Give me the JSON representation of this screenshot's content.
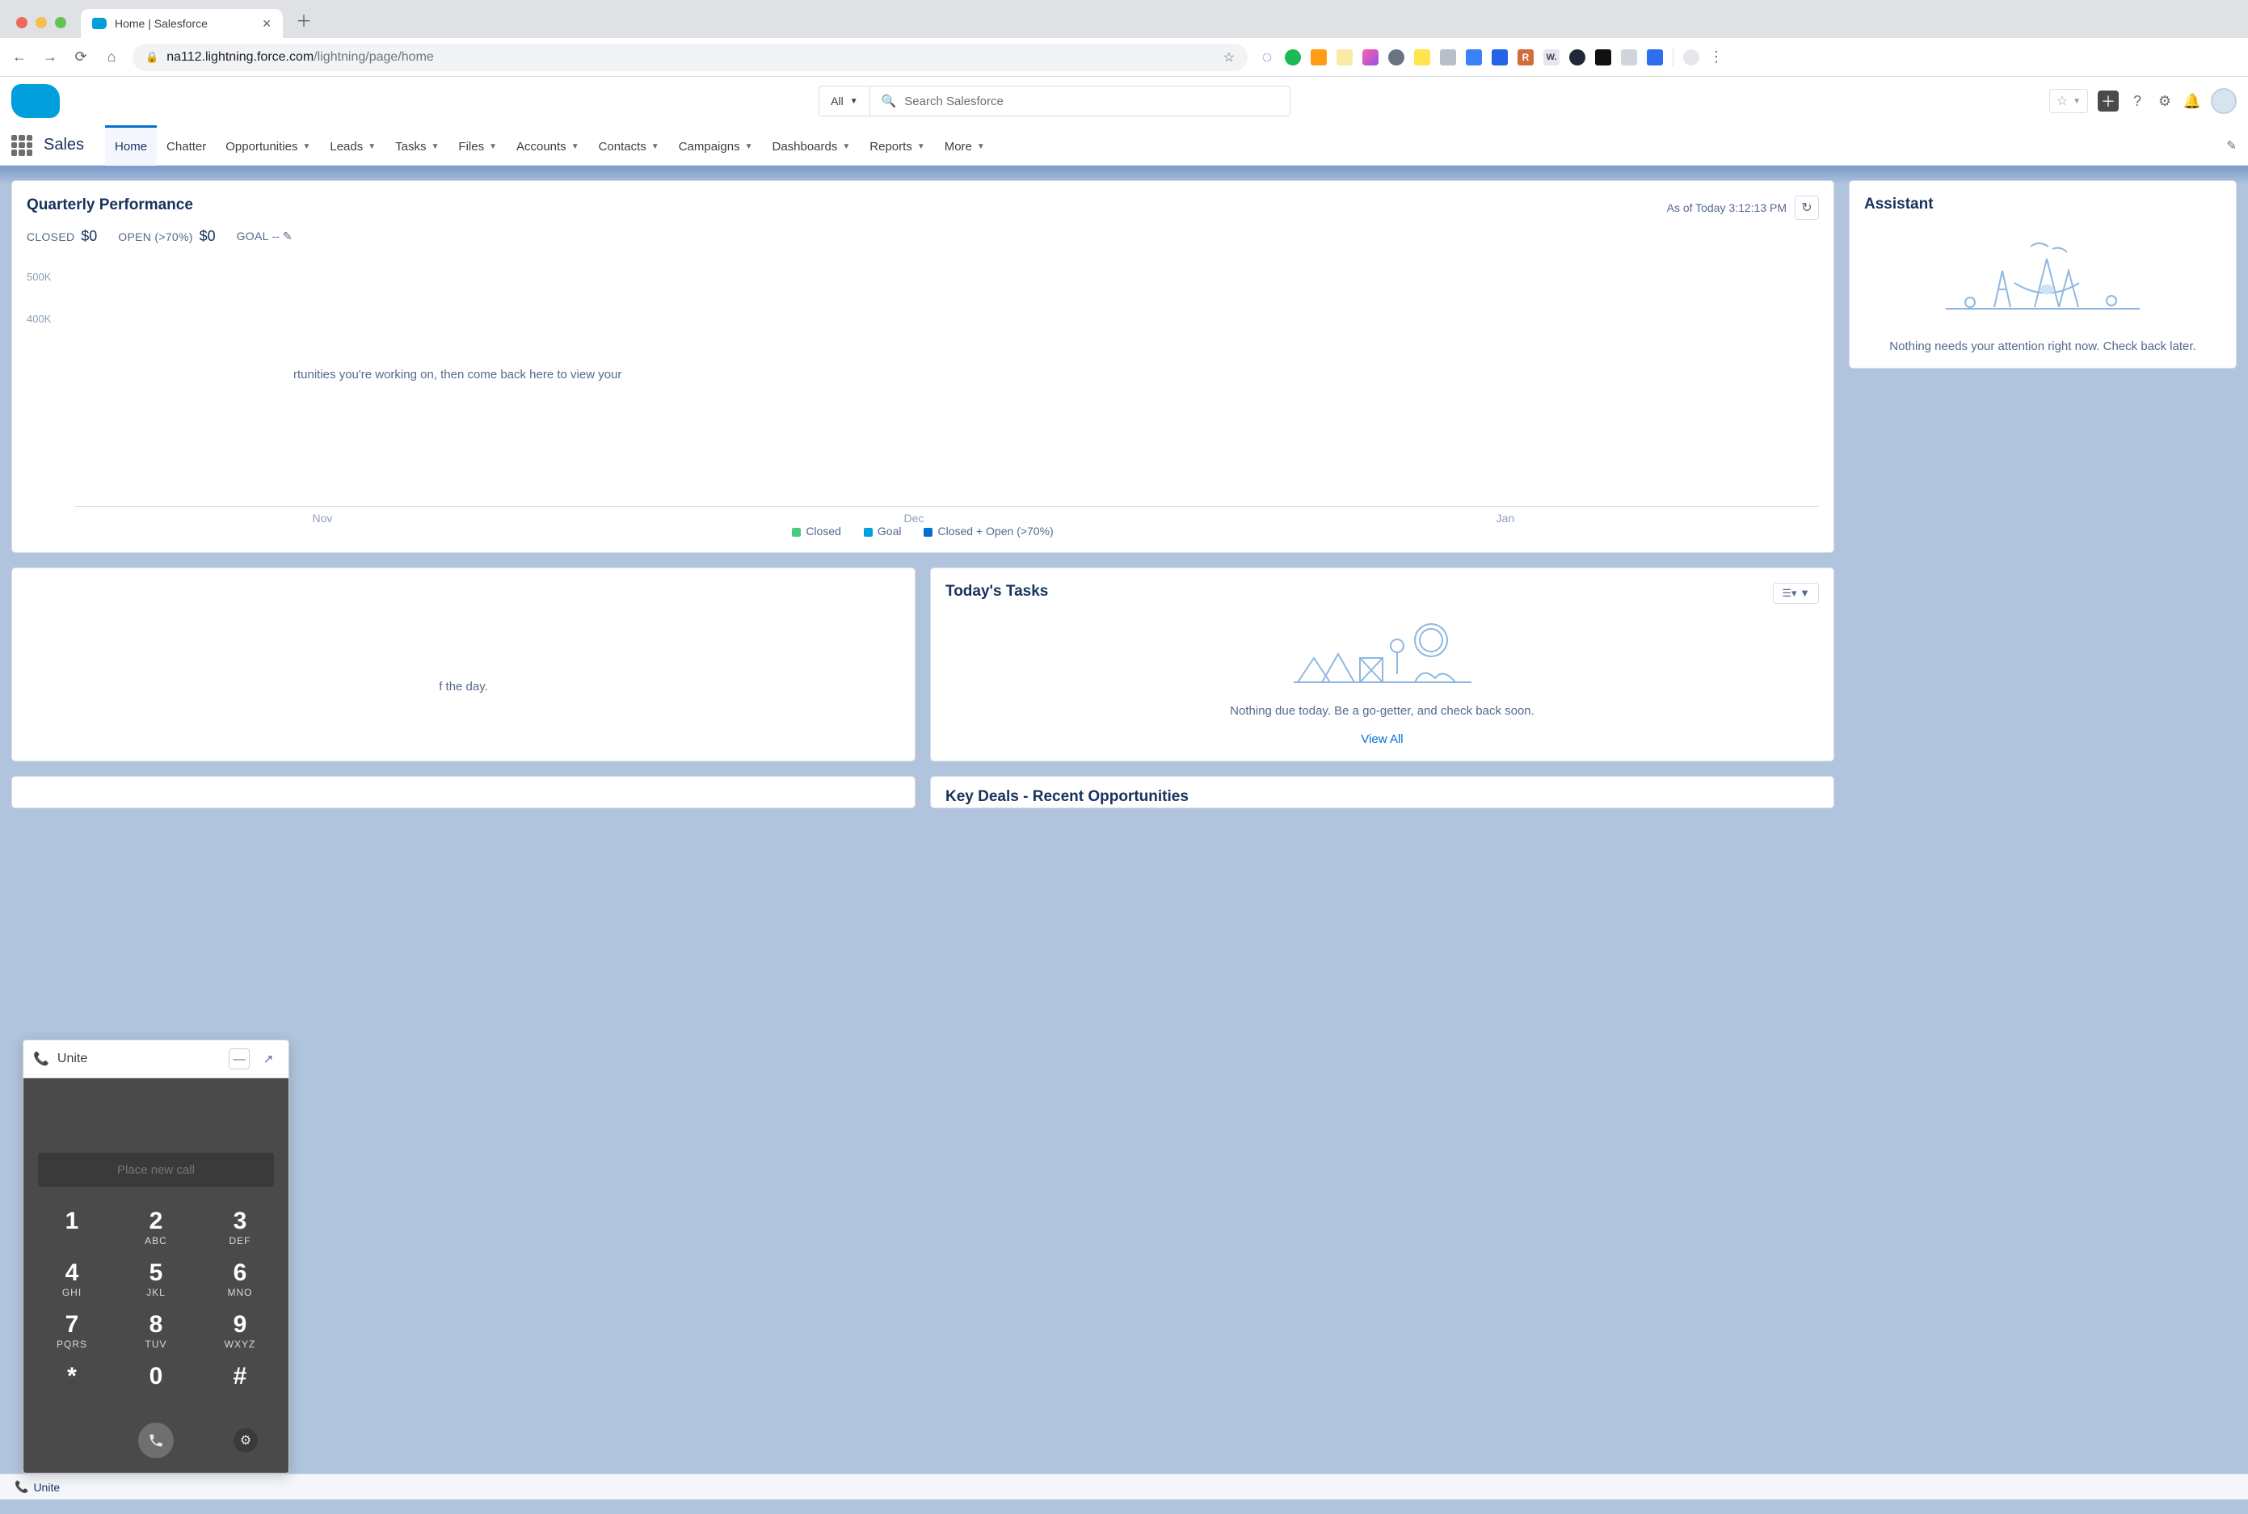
{
  "browser": {
    "tab_title": "Home | Salesforce",
    "url_host": "na112.lightning.force.com",
    "url_path": "/lightning/page/home"
  },
  "header": {
    "search_scope": "All",
    "search_placeholder": "Search Salesforce"
  },
  "nav": {
    "app_name": "Sales",
    "items": [
      "Home",
      "Chatter",
      "Opportunities",
      "Leads",
      "Tasks",
      "Files",
      "Accounts",
      "Contacts",
      "Campaigns",
      "Dashboards",
      "Reports",
      "More"
    ],
    "active": "Home"
  },
  "quarterly": {
    "title": "Quarterly Performance",
    "as_of": "As of Today 3:12:13 PM",
    "closed_label": "CLOSED",
    "closed_value": "$0",
    "open_label": "OPEN (>70%)",
    "open_value": "$0",
    "goal_label": "GOAL",
    "goal_value": "--",
    "hint": "rtunities you're working on, then come back here to view your",
    "legend": {
      "closed": "Closed",
      "goal": "Goal",
      "combo": "Closed + Open (>70%)"
    }
  },
  "chart_data": {
    "type": "bar",
    "categories": [
      "Nov",
      "Dec",
      "Jan"
    ],
    "series": [
      {
        "name": "Closed",
        "values": [
          0,
          0,
          0
        ]
      },
      {
        "name": "Goal",
        "values": [
          0,
          0,
          0
        ]
      },
      {
        "name": "Closed + Open (>70%)",
        "values": [
          0,
          0,
          0
        ]
      }
    ],
    "ylim": [
      0,
      500000
    ],
    "y_ticks": [
      "500K",
      "400K"
    ],
    "xlabel": "",
    "ylabel": "",
    "title": "Quarterly Performance",
    "legend_colors": {
      "Closed": "#4bca81",
      "Goal": "#00a1e0",
      "Closed + Open (>70%)": "#0070d2"
    }
  },
  "events": {
    "msg": "f the day."
  },
  "tasks": {
    "title": "Today's Tasks",
    "msg": "Nothing due today. Be a go-getter, and check back soon.",
    "view_all": "View All"
  },
  "keydeals": {
    "title_partial": "Key Deals - Recent Opportunities"
  },
  "assistant": {
    "title": "Assistant",
    "msg": "Nothing needs your attention right now. Check back later."
  },
  "cti": {
    "title": "Unite",
    "input_placeholder": "Place new call",
    "keys": [
      {
        "num": "1",
        "let": ""
      },
      {
        "num": "2",
        "let": "ABC"
      },
      {
        "num": "3",
        "let": "DEF"
      },
      {
        "num": "4",
        "let": "GHI"
      },
      {
        "num": "5",
        "let": "JKL"
      },
      {
        "num": "6",
        "let": "MNO"
      },
      {
        "num": "7",
        "let": "PQRS"
      },
      {
        "num": "8",
        "let": "TUV"
      },
      {
        "num": "9",
        "let": "WXYZ"
      },
      {
        "num": "*",
        "let": ""
      },
      {
        "num": "0",
        "let": ""
      },
      {
        "num": "#",
        "let": ""
      }
    ]
  },
  "utility": {
    "item_label": "Unite"
  }
}
